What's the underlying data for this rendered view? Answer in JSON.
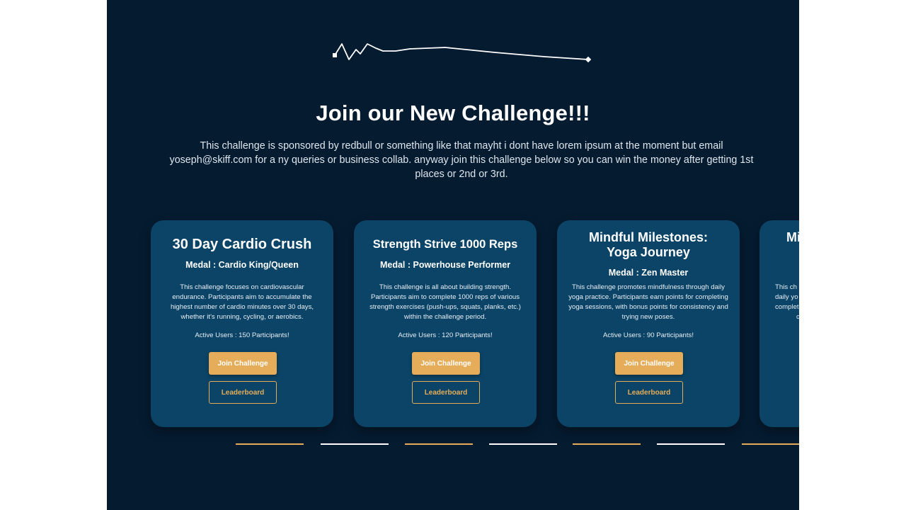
{
  "hero": {
    "title": "Join our New Challenge!!!",
    "description": "This challenge is sponsored by redbull or something like that mayht i dont have lorem ipsum at the moment but email yoseph@skiff.com for a ny queries or business collab. anyway join this challenge below so you can win the money after getting 1st places or 2nd or 3rd."
  },
  "cards": [
    {
      "title": "30 Day Cardio Crush",
      "medal": "Medal : Cardio King/Queen",
      "description": "This challenge focuses on cardiovascular endurance. Participants aim to accumulate the highest number of cardio minutes over 30 days, whether it's running, cycling, or aerobics.",
      "active_users": "Active Users : 150 Participants!",
      "join_label": "Join Challenge",
      "leaderboard_label": "Leaderboard"
    },
    {
      "title": "Strength Strive 1000 Reps",
      "medal": "Medal : Powerhouse Performer",
      "description": "This challenge is all about building strength. Participants aim to complete 1000 reps of various strength exercises (push-ups, squats, planks, etc.) within the challenge period.",
      "active_users": "Active Users : 120 Participants!",
      "join_label": "Join Challenge",
      "leaderboard_label": "Leaderboard"
    },
    {
      "title_line1": "Mindful Milestones:",
      "title_line2": "Yoga Journey",
      "medal": "Medal : Zen Master",
      "description": "This challenge promotes mindfulness through daily yoga practice. Participants earn points for completing yoga sessions, with bonus points for consistency and trying new poses.",
      "active_users": "Active Users : 90 Participants!",
      "join_label": "Join Challenge",
      "leaderboard_label": "Leaderboard"
    },
    {
      "title_fragment": "Mi",
      "description_fragments": [
        "This ch",
        "daily yo",
        "complet",
        "c"
      ]
    }
  ],
  "colors": {
    "background": "#051b30",
    "card": "#0b4466",
    "accent": "#e5ad5a",
    "text": "#ffffff"
  },
  "pager": {
    "count": 7,
    "active_colors": [
      "#e5ad5a",
      "#ffffff",
      "#e5ad5a",
      "#ffffff",
      "#e5ad5a",
      "#ffffff",
      "#e5ad5a"
    ]
  },
  "icons": {
    "logo": "heartbeat-line-icon"
  }
}
